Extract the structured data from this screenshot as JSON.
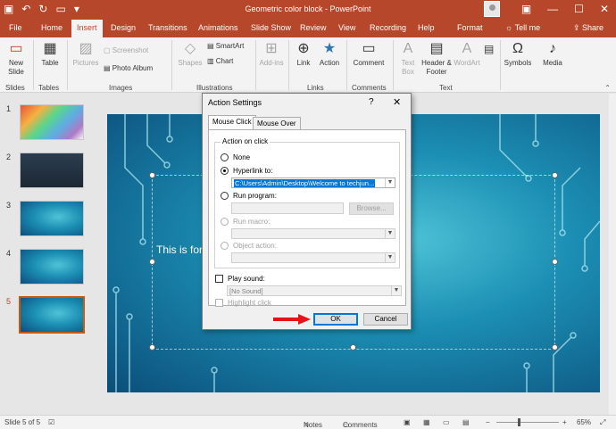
{
  "window": {
    "title": "Geometric color block  -  PowerPoint"
  },
  "ribbon_tabs": [
    "File",
    "Home",
    "Insert",
    "Design",
    "Transitions",
    "Animations",
    "Slide Show",
    "Review",
    "View",
    "Recording",
    "Help",
    "Format"
  ],
  "active_tab": "Insert",
  "tell_me": "Tell me",
  "share": "Share",
  "ribbon": {
    "new_slide": "New Slide",
    "table": "Table",
    "pictures": "Pictures",
    "screenshot": "Screenshot",
    "photo_album": "Photo Album",
    "shapes": "Shapes",
    "smartart": "SmartArt",
    "chart": "Chart",
    "addins": "Add-ins",
    "link": "Link",
    "action": "Action",
    "comment": "Comment",
    "text_box": "Text Box",
    "header_footer": "Header & Footer",
    "wordart": "WordArt",
    "symbols": "Symbols",
    "media": "Media",
    "groups": [
      "Slides",
      "Tables",
      "Images",
      "Illustrations",
      "Links",
      "Comments",
      "Text"
    ]
  },
  "slides": {
    "numbers": [
      "1",
      "2",
      "3",
      "4",
      "5"
    ],
    "active": "5"
  },
  "slide_text": "This is for",
  "status": {
    "slide_count": "Slide 5 of 5",
    "notes": "Notes",
    "comments": "Comments",
    "zoom": "65%"
  },
  "dialog": {
    "title": "Action Settings",
    "help": "?",
    "close": "✕",
    "tabs": [
      "Mouse Click",
      "Mouse Over"
    ],
    "group_label": "Action on click",
    "none": "None",
    "hyperlink_to": "Hyperlink to:",
    "hyperlink_value": "C:\\Users\\Admin\\Desktop\\Welcome to techjun...",
    "run_program": "Run program:",
    "browse": "Browse...",
    "run_macro": "Run macro:",
    "object_action": "Object action:",
    "play_sound": "Play sound:",
    "sound_value": "[No Sound]",
    "highlight_click": "Highlight click",
    "ok": "OK",
    "cancel": "Cancel"
  },
  "colors": {
    "accent": "#b7472a",
    "annotation_arrow": "#e8111a"
  },
  "icons": [
    "undo-icon",
    "redo-icon",
    "save-icon",
    "search-icon",
    "link-icon",
    "action-icon",
    "dropdown-icon"
  ]
}
